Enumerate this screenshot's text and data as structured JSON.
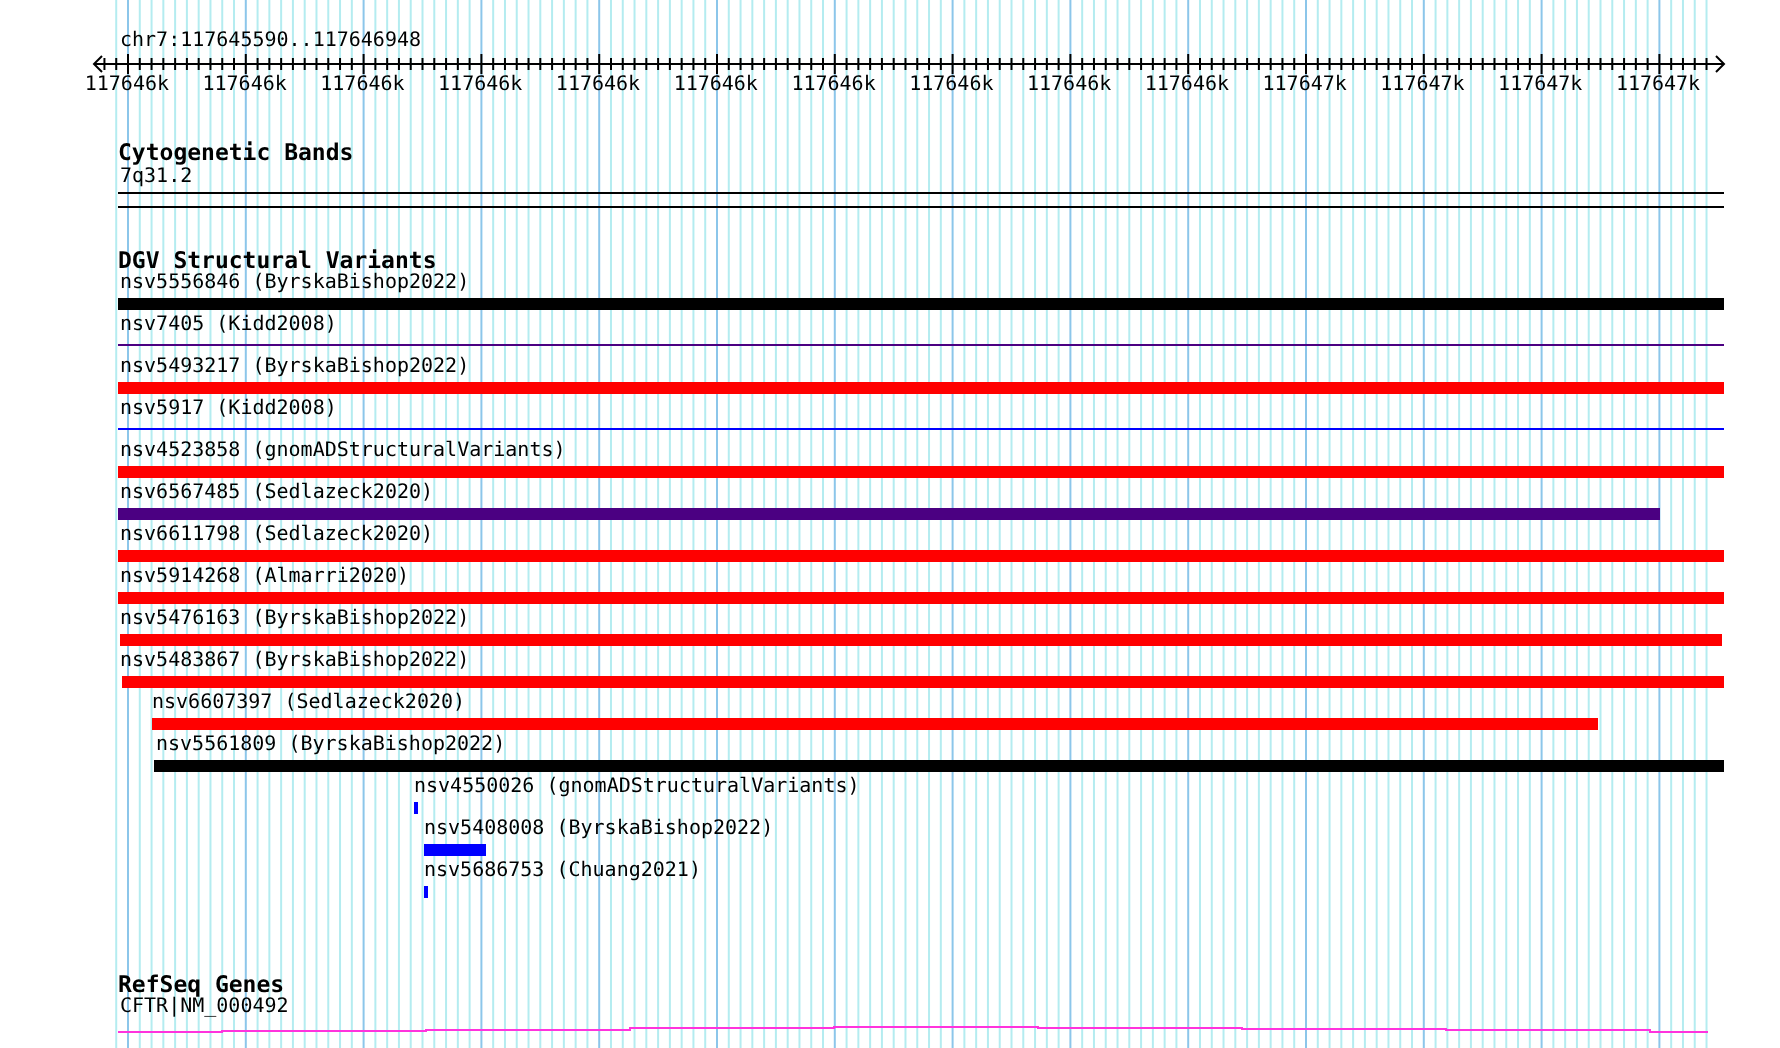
{
  "location": "chr7:117645590..117646948",
  "ruler": {
    "ticks": [
      "117646k",
      "117646k",
      "117646k",
      "117646k",
      "117646k",
      "117646k",
      "117646k",
      "117646k",
      "117646k",
      "117646k",
      "117647k",
      "117647k",
      "117647k",
      "117647k"
    ]
  },
  "cytogenetic_bands": {
    "title": "Cytogenetic Bands",
    "band": "7q31.2"
  },
  "dgv_structural_variants": {
    "title": "DGV Structural Variants",
    "variants": [
      {
        "label": "nsv5556846 (ByrskaBishop2022)",
        "color": "#000000",
        "kind": "thick"
      },
      {
        "label": "nsv7405 (Kidd2008)",
        "color": "#4b0082",
        "kind": "thin"
      },
      {
        "label": "nsv5493217 (ByrskaBishop2022)",
        "color": "#ff0000",
        "kind": "thick"
      },
      {
        "label": "nsv5917 (Kidd2008)",
        "color": "#0000ff",
        "kind": "thin"
      },
      {
        "label": "nsv4523858 (gnomADStructuralVariants)",
        "color": "#ff0000",
        "kind": "thick"
      },
      {
        "label": "nsv6567485 (Sedlazeck2020)",
        "color": "#4b0082",
        "kind": "thick"
      },
      {
        "label": "nsv6611798 (Sedlazeck2020)",
        "color": "#ff0000",
        "kind": "thick"
      },
      {
        "label": "nsv5914268 (Almarri2020)",
        "color": "#ff0000",
        "kind": "thick"
      },
      {
        "label": "nsv5476163 (ByrskaBishop2022)",
        "color": "#ff0000",
        "kind": "thick"
      },
      {
        "label": "nsv5483867 (ByrskaBishop2022)",
        "color": "#ff0000",
        "kind": "thick"
      },
      {
        "label": "nsv6607397 (Sedlazeck2020)",
        "color": "#ff0000",
        "kind": "thick"
      },
      {
        "label": "nsv5561809 (ByrskaBishop2022)",
        "color": "#000000",
        "kind": "thick"
      },
      {
        "label": "nsv4550026 (gnomADStructuralVariants)",
        "color": "#0000ff",
        "kind": "thick"
      },
      {
        "label": "nsv5408008 (ByrskaBishop2022)",
        "color": "#0000ff",
        "kind": "thick"
      },
      {
        "label": "nsv5686753 (Chuang2021)",
        "color": "#0000ff",
        "kind": "thick"
      }
    ]
  },
  "refseq_genes": {
    "title": "RefSeq Genes",
    "gene": "CFTR|NM_000492"
  }
}
